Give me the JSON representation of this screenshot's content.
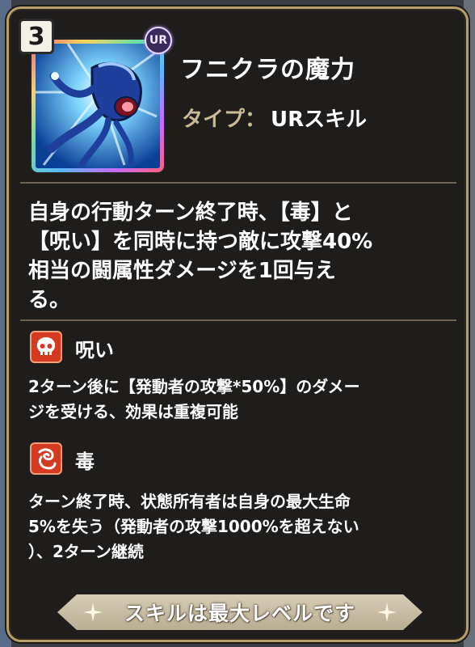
{
  "skill": {
    "level": "3",
    "rarity_badge": "UR",
    "name": "フニクラの魔力",
    "type_label": "タイプ：",
    "type_value": "URスキル"
  },
  "description_lines": [
    "自身の行動ターン終了時、【毒】と",
    "【呪い】を同時に持つ敵に攻撃40%",
    "相当の闘属性ダメージを1回与え",
    "る。"
  ],
  "effects": [
    {
      "icon": "skull-icon",
      "title": "呪い",
      "lines": [
        "2ターン後に【発動者の攻撃*50%】のダメー",
        "ジを受ける、効果は重複可能"
      ]
    },
    {
      "icon": "poison-icon",
      "title": "毒",
      "lines": [
        "ターン終了時、状態所有者は自身の最大生命",
        "5%を失う（発動者の攻撃1000%を超えない",
        "）、2ターン継続"
      ]
    }
  ],
  "footer": {
    "text": "スキルは最大レベルです"
  },
  "colors": {
    "panel_border": "#b89f6a",
    "type_label": "#c9bb98",
    "effect_icon_bg": "#d43a1f"
  }
}
